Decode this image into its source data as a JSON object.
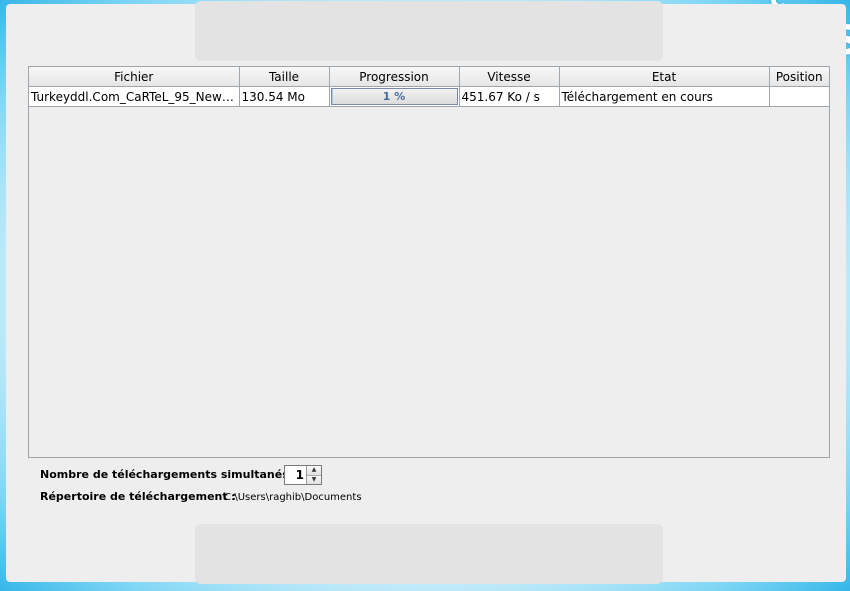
{
  "table": {
    "columns": [
      "Fichier",
      "Taille",
      "Progression",
      "Vitesse",
      "Etat",
      "Position"
    ],
    "rows": [
      {
        "fichier": "Turkeyddl.Com_CaRTeL_95_New_...",
        "taille": "130.54 Mo",
        "progression_label": "1 %",
        "progression_fraction": 0.01,
        "vitesse": "451.67 Ko / s",
        "etat": "Téléchargement en cours",
        "position": ""
      }
    ]
  },
  "settings": {
    "simultaneous_label": "Nombre de téléchargements simultanés :",
    "simultaneous_value": "1",
    "directory_label": "Répertoire de téléchargement :",
    "directory_value": "C:\\Users\\raghib\\Documents"
  },
  "icons": {
    "spin_up": "chevron-up-icon",
    "spin_down": "chevron-down-icon"
  },
  "colors": {
    "background_glow": "#35b6e8",
    "panel": "#eeeeee",
    "progress_text": "#4a6aa0"
  }
}
